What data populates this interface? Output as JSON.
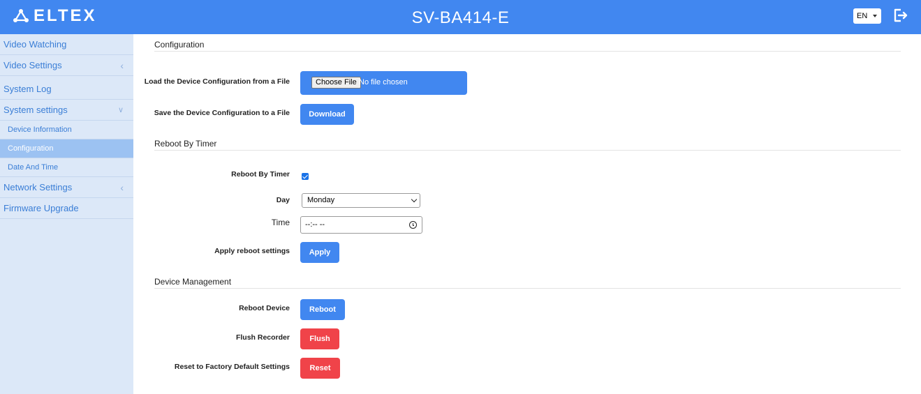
{
  "header": {
    "logo_text": "ELTEX",
    "device_title": "SV-BA414-E",
    "language": "EN"
  },
  "sidebar": {
    "items": [
      {
        "label": "Video Watching"
      },
      {
        "label": "Video Settings"
      },
      {
        "label": "System Log"
      },
      {
        "label": "System settings"
      },
      {
        "label": "Device Information"
      },
      {
        "label": "Configuration"
      },
      {
        "label": "Date And Time"
      },
      {
        "label": "Network Settings"
      },
      {
        "label": "Firmware Upgrade"
      }
    ]
  },
  "configuration": {
    "title": "Configuration",
    "load_label": "Load the Device Configuration from a File",
    "choose_file_label": "Choose File",
    "no_file_text": "No file chosen",
    "save_label": "Save the Device Configuration to a File",
    "download_label": "Download"
  },
  "reboot_timer": {
    "title": "Reboot By Timer",
    "enable_label": "Reboot By Timer",
    "enabled": true,
    "day_label": "Day",
    "day_value": "Monday",
    "time_label": "Time",
    "time_value": "--:-- --",
    "apply_label": "Apply reboot settings",
    "apply_button": "Apply"
  },
  "device_management": {
    "title": "Device Management",
    "reboot_label": "Reboot Device",
    "reboot_button": "Reboot",
    "flush_label": "Flush Recorder",
    "flush_button": "Flush",
    "reset_label": "Reset to Factory Default Settings",
    "reset_button": "Reset"
  },
  "colors": {
    "header_bg": "#4187f0",
    "sidebar_bg": "#dce8f8",
    "active_item_bg": "#9cc2f2",
    "primary_button": "#4187f0",
    "danger_button": "#f04349"
  }
}
